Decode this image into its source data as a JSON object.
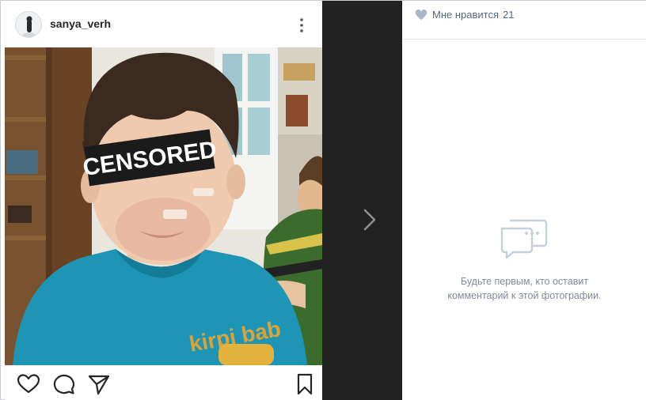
{
  "post": {
    "username": "sanya_verh",
    "photo": {
      "censor_label": "CENSORED",
      "shirt_text": "kirpi bab"
    },
    "actions": [
      "like-icon",
      "comment-icon",
      "share-icon",
      "bookmark-icon"
    ]
  },
  "navigation": {
    "next_icon": "chevron-right-icon"
  },
  "sidebar": {
    "likes_label": "Мне нравится",
    "likes_count": "21",
    "empty_line1": "Будьте первым, кто оставит",
    "empty_line2": "комментарий к этой фотографии."
  },
  "colors": {
    "dark_strip": "#222222",
    "link_text": "#55677d",
    "muted_text": "#828a99",
    "heart": "#a8b6c8"
  }
}
